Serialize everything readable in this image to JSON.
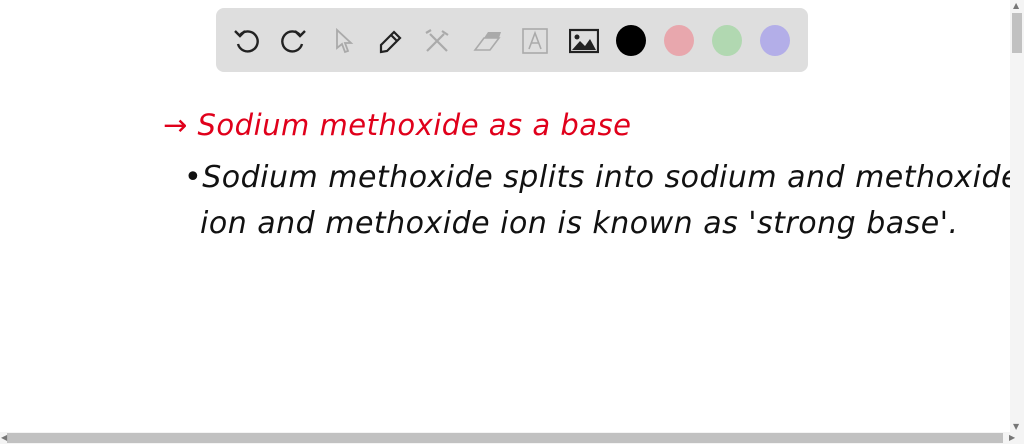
{
  "toolbar": {
    "tools": [
      "undo-icon",
      "redo-icon",
      "pointer-icon",
      "pen-icon",
      "tools-icon",
      "eraser-icon",
      "text-icon",
      "image-icon"
    ],
    "colors": [
      "#000000",
      "#e8a7ad",
      "#b1d8b1",
      "#b3aee8"
    ]
  },
  "canvas": {
    "title": "→ Sodium methoxide as a base",
    "line1": "•Sodium methoxide splits into sodium and methoxide",
    "line2": "ion and methoxide ion is known as 'strong base'.",
    "title_color": "#e0001b"
  }
}
